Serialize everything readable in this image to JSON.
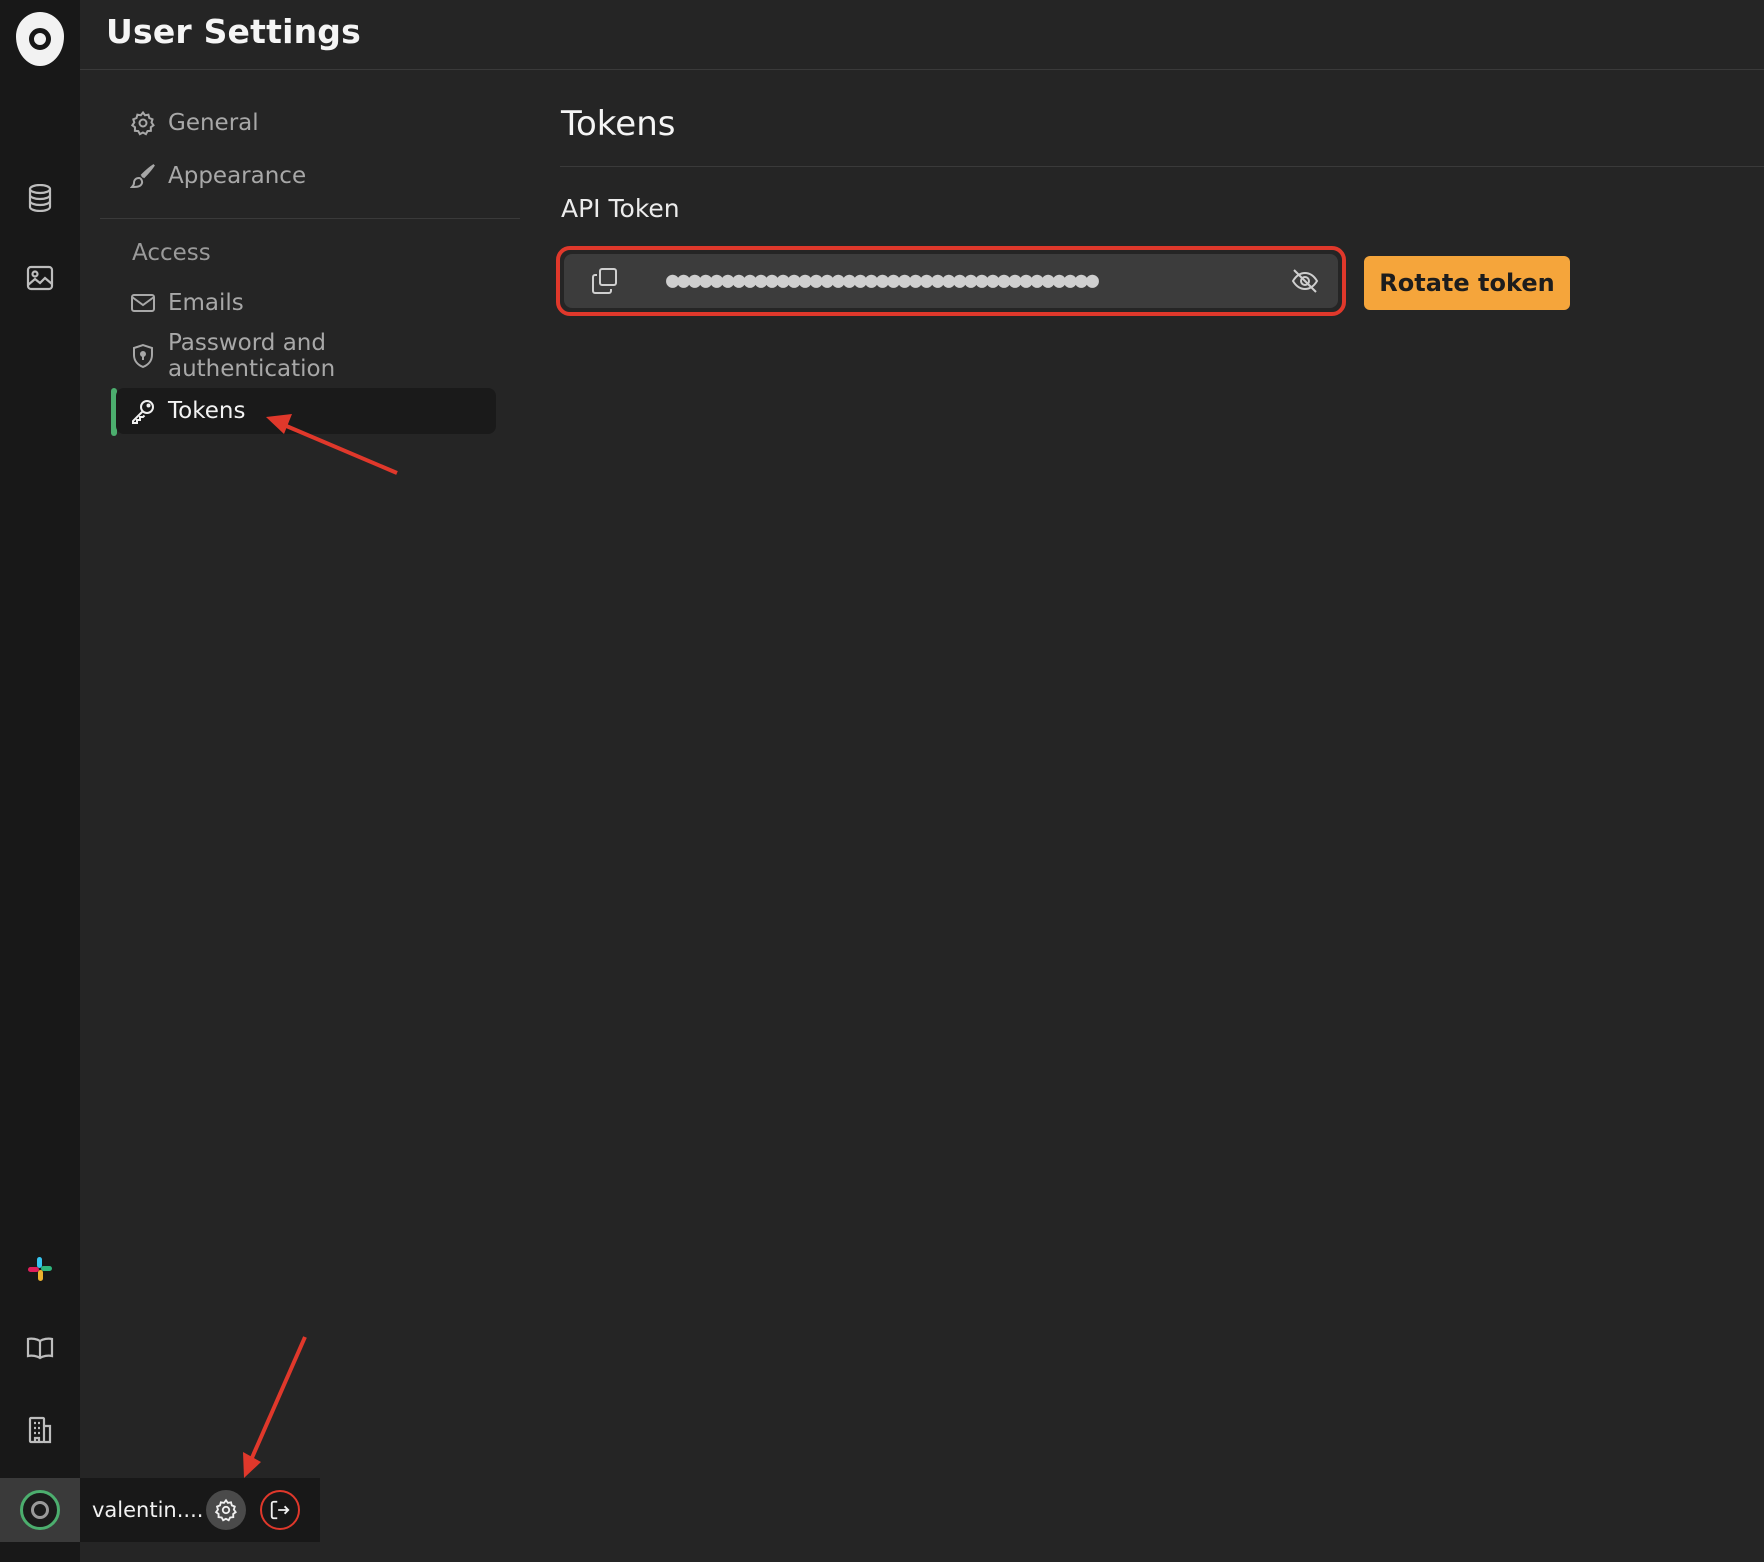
{
  "header": {
    "title": "User Settings"
  },
  "rail": {
    "logo": "app-logo",
    "items": [
      {
        "icon": "database-icon"
      },
      {
        "icon": "image-icon"
      },
      {
        "icon": "slack-icon"
      },
      {
        "icon": "book-icon"
      },
      {
        "icon": "building-icon"
      }
    ]
  },
  "settings_nav": {
    "items": [
      {
        "label": "General",
        "icon": "gear-icon"
      },
      {
        "label": "Appearance",
        "icon": "paintbrush-icon"
      }
    ],
    "section_label": "Access",
    "access_items": [
      {
        "label": "Emails",
        "icon": "envelope-icon"
      },
      {
        "label": "Password and authentication",
        "icon": "shield-icon"
      },
      {
        "label": "Tokens",
        "icon": "key-icon",
        "active": true
      }
    ]
  },
  "main": {
    "title": "Tokens",
    "api_token": {
      "label": "API Token",
      "masked_value": "●●●●●●●●●●●●●●●●●●●●●●●●●●●●●●●●●●●●●●●",
      "copy_icon": "copy-icon",
      "visibility_icon": "eye-off-icon"
    },
    "rotate_button": "Rotate token"
  },
  "user": {
    "name": "valentin....",
    "settings_icon": "gear-icon",
    "logout_icon": "logout-icon"
  },
  "colors": {
    "background": "#252525",
    "rail": "#181818",
    "accent_green": "#4cae6e",
    "accent_orange": "#f5a53b",
    "highlight_red": "#e0382b"
  }
}
